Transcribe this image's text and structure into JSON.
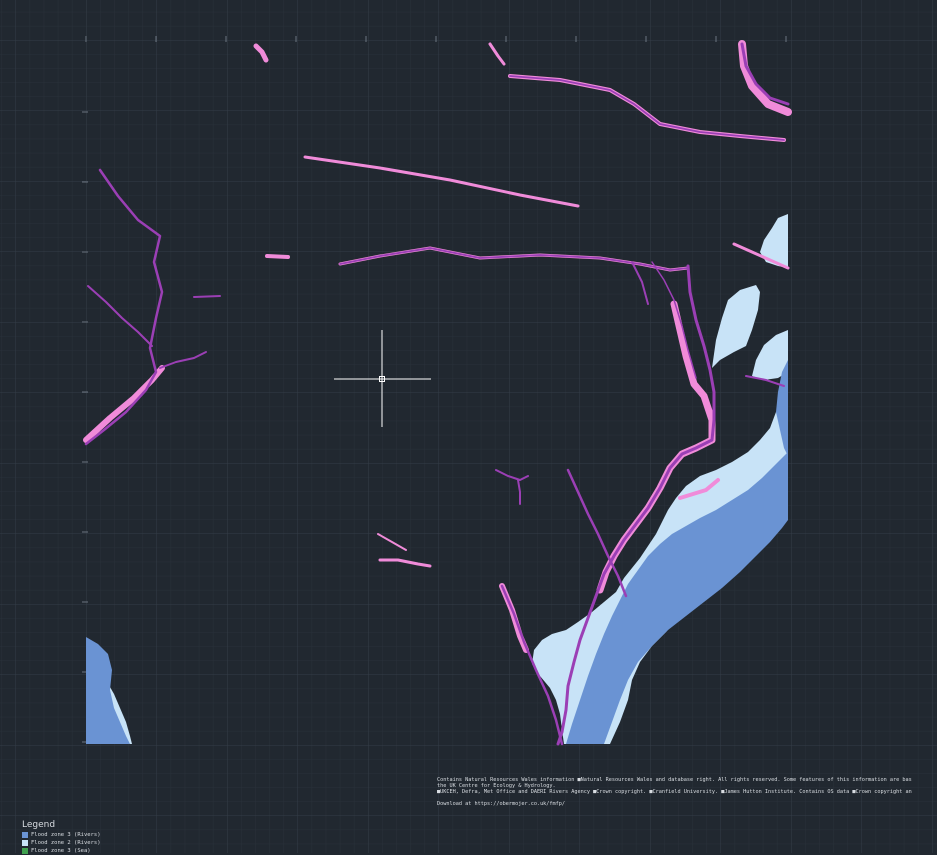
{
  "colors": {
    "background": "#212830",
    "grid_minor": "#29313a",
    "grid_major": "#333c46",
    "flood_zone_3_rivers": "#6a93d3",
    "flood_zone_2_rivers": "#c8e3f7",
    "flood_zone_3_sea": "#3fa04e",
    "river_purple": "#9b3fb5",
    "river_pink": "#f08bd9",
    "crosshair": "#ffffff"
  },
  "attribution": {
    "line1": "Contains Natural Resources Wales information ■Natural Resources Wales and database right. All rights reserved. Some features of this information are bas",
    "line2": "the UK Centre for Ecology & Hydrology.",
    "line3": "■UKCEH, Defra, Met Office and DAERI Rivers Agency ■Crown copyright. ■Cranfield University. ■James Hutton Institute. Contains OS data ■Crown copyright an"
  },
  "download_text": "Download at https://obermojer.co.uk/fmfp/",
  "legend": {
    "title": "Legend",
    "items": [
      {
        "label": "Flood zone 3 (Rivers)",
        "color": "#6a93d3"
      },
      {
        "label": "Flood zone 2 (Rivers)",
        "color": "#c8e3f7"
      },
      {
        "label": "Flood zone 3 (Sea)",
        "color": "#3fa04e"
      }
    ]
  },
  "icons": {
    "cursor": "crosshair-icon"
  }
}
